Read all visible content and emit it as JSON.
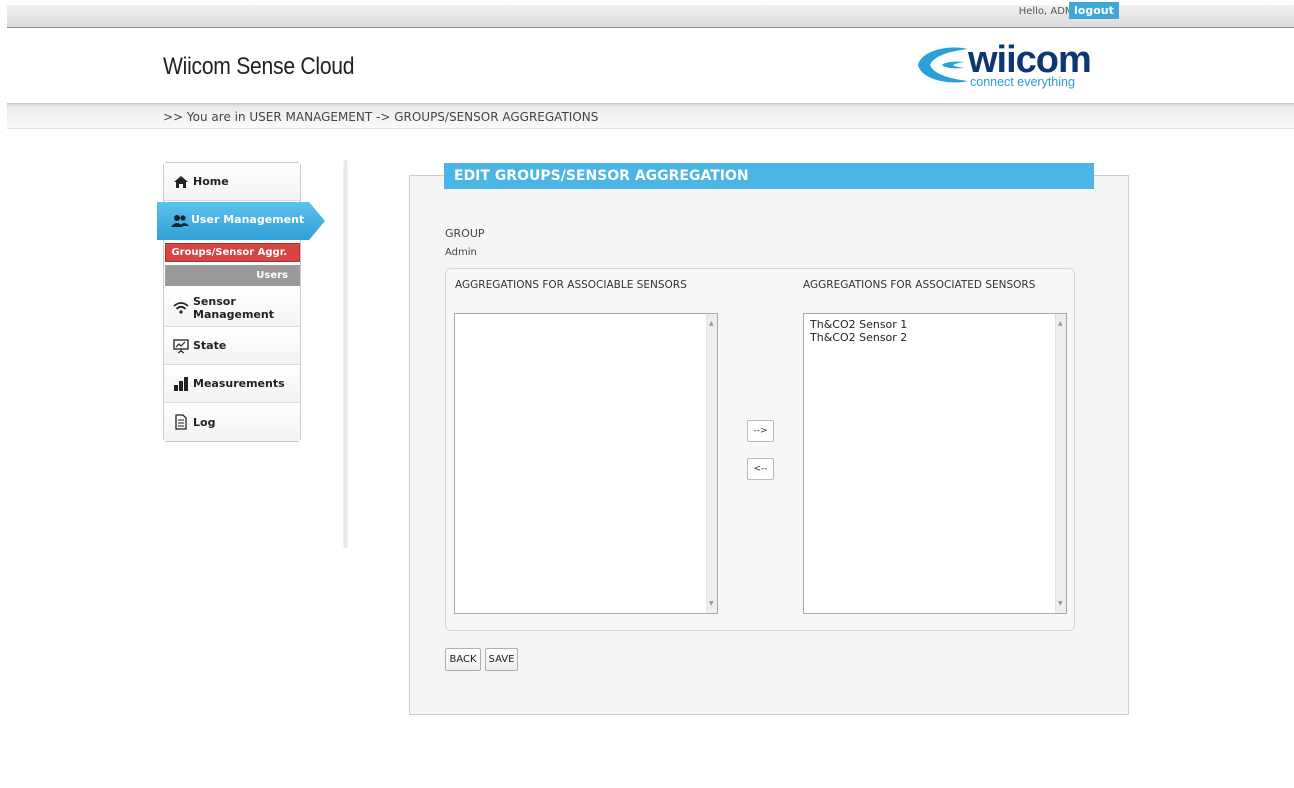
{
  "topbar": {
    "greeting": "Hello,  ADMIN",
    "logout_label": "logout"
  },
  "header": {
    "app_title": "Wiicom Sense Cloud",
    "logo_word": "wiicom",
    "logo_tagline": "connect everything"
  },
  "breadcrumb": ">> You are in USER MANAGEMENT -> GROUPS/SENSOR AGGREGATIONS",
  "menu": {
    "home": "Home",
    "user_management": "User Management",
    "sub_groups": "Groups/Sensor Aggr.",
    "sub_users": "Users",
    "sensor_management": "Sensor Management",
    "state": "State",
    "measurements": "Measurements",
    "log": "Log"
  },
  "panel": {
    "title": "EDIT GROUPS/SENSOR AGGREGATION",
    "group_label": "GROUP",
    "group_value": "Admin",
    "left_title": "AGGREGATIONS FOR ASSOCIABLE SENSORS",
    "right_title": "AGGREGATIONS FOR ASSOCIATED SENSORS",
    "left_items": [],
    "right_items": [
      "Th&CO2 Sensor 1",
      "Th&CO2 Sensor 2"
    ],
    "add_label": "-->",
    "remove_label": "<--",
    "back_label": "BACK",
    "save_label": "SAVE"
  },
  "colors": {
    "accent": "#4bb6e6",
    "active_sub": "#d64541",
    "brand_navy": "#0d3770"
  }
}
